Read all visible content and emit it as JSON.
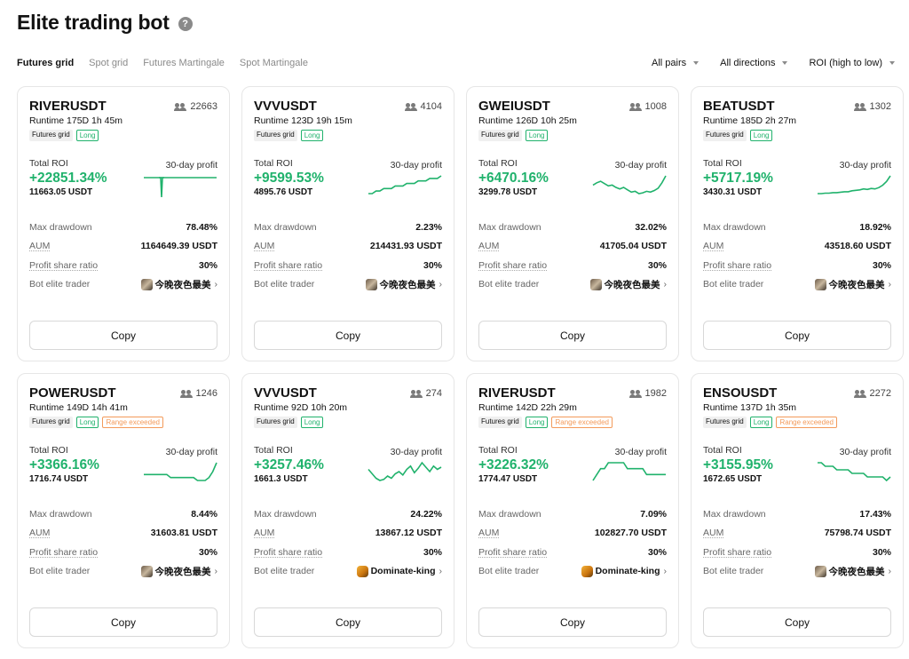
{
  "header": {
    "title": "Elite trading bot",
    "help_icon": "question-circle-icon"
  },
  "tabs": [
    {
      "label": "Futures grid",
      "active": true
    },
    {
      "label": "Spot grid",
      "active": false
    },
    {
      "label": "Futures Martingale",
      "active": false
    },
    {
      "label": "Spot Martingale",
      "active": false
    }
  ],
  "filters": [
    {
      "label": "All pairs"
    },
    {
      "label": "All directions"
    },
    {
      "label": "ROI (high to low)"
    }
  ],
  "labels": {
    "total_roi": "Total ROI",
    "profit_30d": "30-day profit",
    "max_drawdown": "Max drawdown",
    "aum": "AUM",
    "profit_share": "Profit share ratio",
    "bot_trader": "Bot elite trader",
    "copy": "Copy"
  },
  "colors": {
    "positive": "#20b26c",
    "range_tag": "#f39a5a"
  },
  "cards": [
    {
      "pair": "RIVERUSDT",
      "followers": "22663",
      "runtime": "Runtime 175D 1h 45m",
      "tags": [
        "Futures grid",
        "Long"
      ],
      "roi": "+22851.34%",
      "roi_usdt": "11663.05 USDT",
      "max_drawdown": "78.48%",
      "aum": "1164649.39 USDT",
      "profit_share": "30%",
      "trader": "今晚夜色最美",
      "avatar": "photo",
      "spark": [
        50,
        50,
        50,
        50,
        50,
        50,
        50,
        50,
        50,
        50,
        50,
        50,
        50,
        50,
        50,
        50,
        50,
        50,
        50,
        50,
        50,
        50,
        50,
        50,
        50,
        50,
        50,
        50,
        50,
        50,
        50,
        50,
        50,
        50,
        50,
        50,
        50,
        50,
        50,
        50
      ]
    },
    {
      "pair": "VVVUSDT",
      "followers": "4104",
      "runtime": "Runtime 123D 19h 15m",
      "tags": [
        "Futures grid",
        "Long"
      ],
      "roi": "+9599.53%",
      "roi_usdt": "4895.76 USDT",
      "max_drawdown": "2.23%",
      "aum": "214431.93 USDT",
      "profit_share": "30%",
      "trader": "今晚夜色最美",
      "avatar": "photo",
      "spark": [
        46,
        46,
        47,
        47,
        48,
        48,
        48,
        49,
        49,
        49,
        50,
        50,
        50,
        51,
        51,
        51,
        52,
        52,
        52,
        53
      ]
    },
    {
      "pair": "GWEIUSDT",
      "followers": "1008",
      "runtime": "Runtime 126D 10h 25m",
      "tags": [
        "Futures grid",
        "Long"
      ],
      "roi": "+6470.16%",
      "roi_usdt": "3299.78 USDT",
      "max_drawdown": "32.02%",
      "aum": "41705.04 USDT",
      "profit_share": "30%",
      "trader": "今晚夜色最美",
      "avatar": "photo",
      "spark": [
        50,
        53,
        55,
        52,
        49,
        50,
        47,
        45,
        47,
        44,
        41,
        42,
        39,
        40,
        42,
        41,
        43,
        46,
        53,
        62
      ]
    },
    {
      "pair": "BEATUSDT",
      "followers": "1302",
      "runtime": "Runtime 185D 2h 27m",
      "tags": [
        "Futures grid",
        "Long"
      ],
      "roi": "+5717.19%",
      "roi_usdt": "3430.31 USDT",
      "max_drawdown": "18.92%",
      "aum": "43518.60 USDT",
      "profit_share": "30%",
      "trader": "今晚夜色最美",
      "avatar": "photo",
      "spark": [
        2,
        2,
        3,
        3,
        4,
        4,
        5,
        6,
        6,
        8,
        9,
        10,
        12,
        11,
        13,
        12,
        15,
        20,
        28,
        40
      ]
    },
    {
      "pair": "POWERUSDT",
      "followers": "1246",
      "runtime": "Runtime 149D 14h 41m",
      "tags": [
        "Futures grid",
        "Long",
        "Range exceeded"
      ],
      "roi": "+3366.16%",
      "roi_usdt": "1716.74 USDT",
      "max_drawdown": "8.44%",
      "aum": "31603.81 USDT",
      "profit_share": "30%",
      "trader": "今晚夜色最美",
      "avatar": "photo",
      "spark": [
        50,
        50,
        50,
        50,
        50,
        50,
        50,
        49,
        49,
        49,
        49,
        49,
        49,
        49,
        48,
        48,
        48,
        49,
        51,
        54
      ]
    },
    {
      "pair": "VVVUSDT",
      "followers": "274",
      "runtime": "Runtime 92D 10h 20m",
      "tags": [
        "Futures grid",
        "Long"
      ],
      "roi": "+3257.46%",
      "roi_usdt": "1661.3 USDT",
      "max_drawdown": "24.22%",
      "aum": "13867.12 USDT",
      "profit_share": "30%",
      "trader": "Dominate-king",
      "avatar": "gold",
      "spark": [
        52,
        48,
        44,
        42,
        43,
        46,
        44,
        48,
        50,
        47,
        52,
        55,
        49,
        53,
        58,
        54,
        50,
        55,
        52,
        54
      ]
    },
    {
      "pair": "RIVERUSDT",
      "followers": "1982",
      "runtime": "Runtime 142D 22h 29m",
      "tags": [
        "Futures grid",
        "Long",
        "Range exceeded"
      ],
      "roi": "+3226.32%",
      "roi_usdt": "1774.47 USDT",
      "max_drawdown": "7.09%",
      "aum": "102827.70 USDT",
      "profit_share": "30%",
      "trader": "Dominate-king",
      "avatar": "gold",
      "spark": [
        50,
        51,
        52,
        52,
        53,
        53,
        53,
        53,
        53,
        52,
        52,
        52,
        52,
        52,
        51,
        51,
        51,
        51,
        51,
        51
      ]
    },
    {
      "pair": "ENSOUSDT",
      "followers": "2272",
      "runtime": "Runtime 137D 1h 35m",
      "tags": [
        "Futures grid",
        "Long",
        "Range exceeded"
      ],
      "roi": "+3155.95%",
      "roi_usdt": "1672.65 USDT",
      "max_drawdown": "17.43%",
      "aum": "75798.74 USDT",
      "profit_share": "30%",
      "trader": "今晚夜色最美",
      "avatar": "photo",
      "spark": [
        54,
        54,
        53,
        53,
        53,
        52,
        52,
        52,
        52,
        51,
        51,
        51,
        51,
        50,
        50,
        50,
        50,
        50,
        49,
        50
      ]
    }
  ]
}
